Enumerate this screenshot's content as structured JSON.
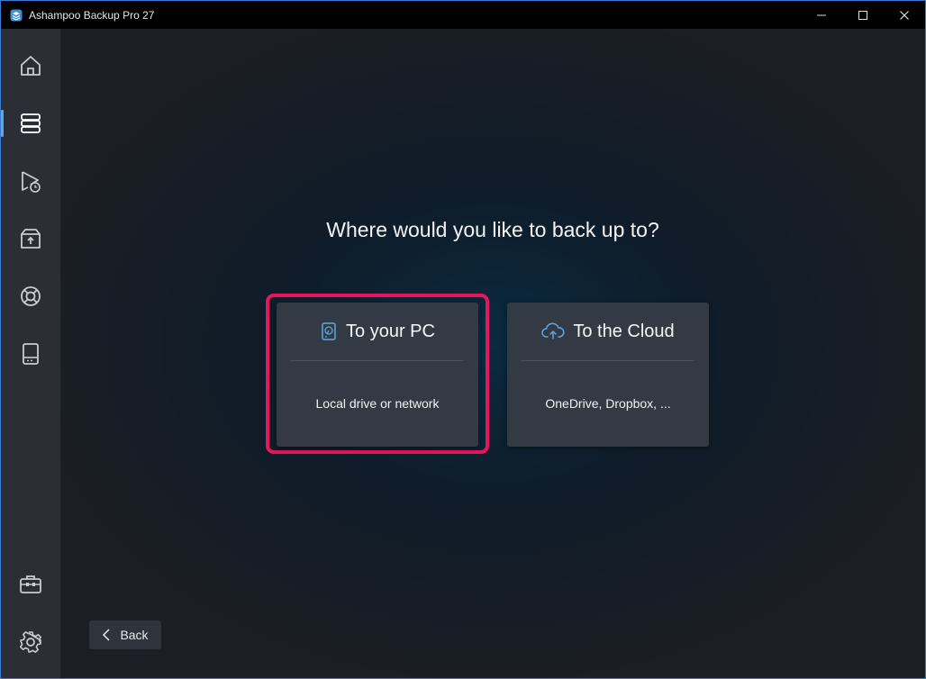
{
  "window": {
    "title": "Ashampoo Backup Pro 27",
    "app_icon": "ashampoo-backup-icon",
    "controls": [
      "minimize-icon",
      "maximize-icon",
      "close-icon"
    ]
  },
  "sidebar": {
    "items": [
      {
        "icon": "home-icon",
        "active": false
      },
      {
        "icon": "backup-plans-icon",
        "active": true
      },
      {
        "icon": "restore-play-clock-icon",
        "active": false
      },
      {
        "icon": "archive-upload-icon",
        "active": false
      },
      {
        "icon": "lifebuoy-icon",
        "active": false
      },
      {
        "icon": "drive-icon",
        "active": false
      }
    ],
    "bottom_items": [
      {
        "icon": "toolbox-icon"
      },
      {
        "icon": "gear-icon"
      }
    ]
  },
  "main": {
    "heading": "Where would you like to back up to?",
    "options": [
      {
        "title": "To your PC",
        "subtitle": "Local drive or network",
        "icon": "hard-drive-icon",
        "highlighted": true
      },
      {
        "title": "To the Cloud",
        "subtitle": "OneDrive, Dropbox, ...",
        "icon": "cloud-upload-icon",
        "highlighted": false
      }
    ],
    "back_label": "Back"
  },
  "colors": {
    "accent": "#5aa9e6",
    "highlight": "#e5165b",
    "card_bg": "#343a44",
    "sidebar_bg": "#2b2e35"
  }
}
